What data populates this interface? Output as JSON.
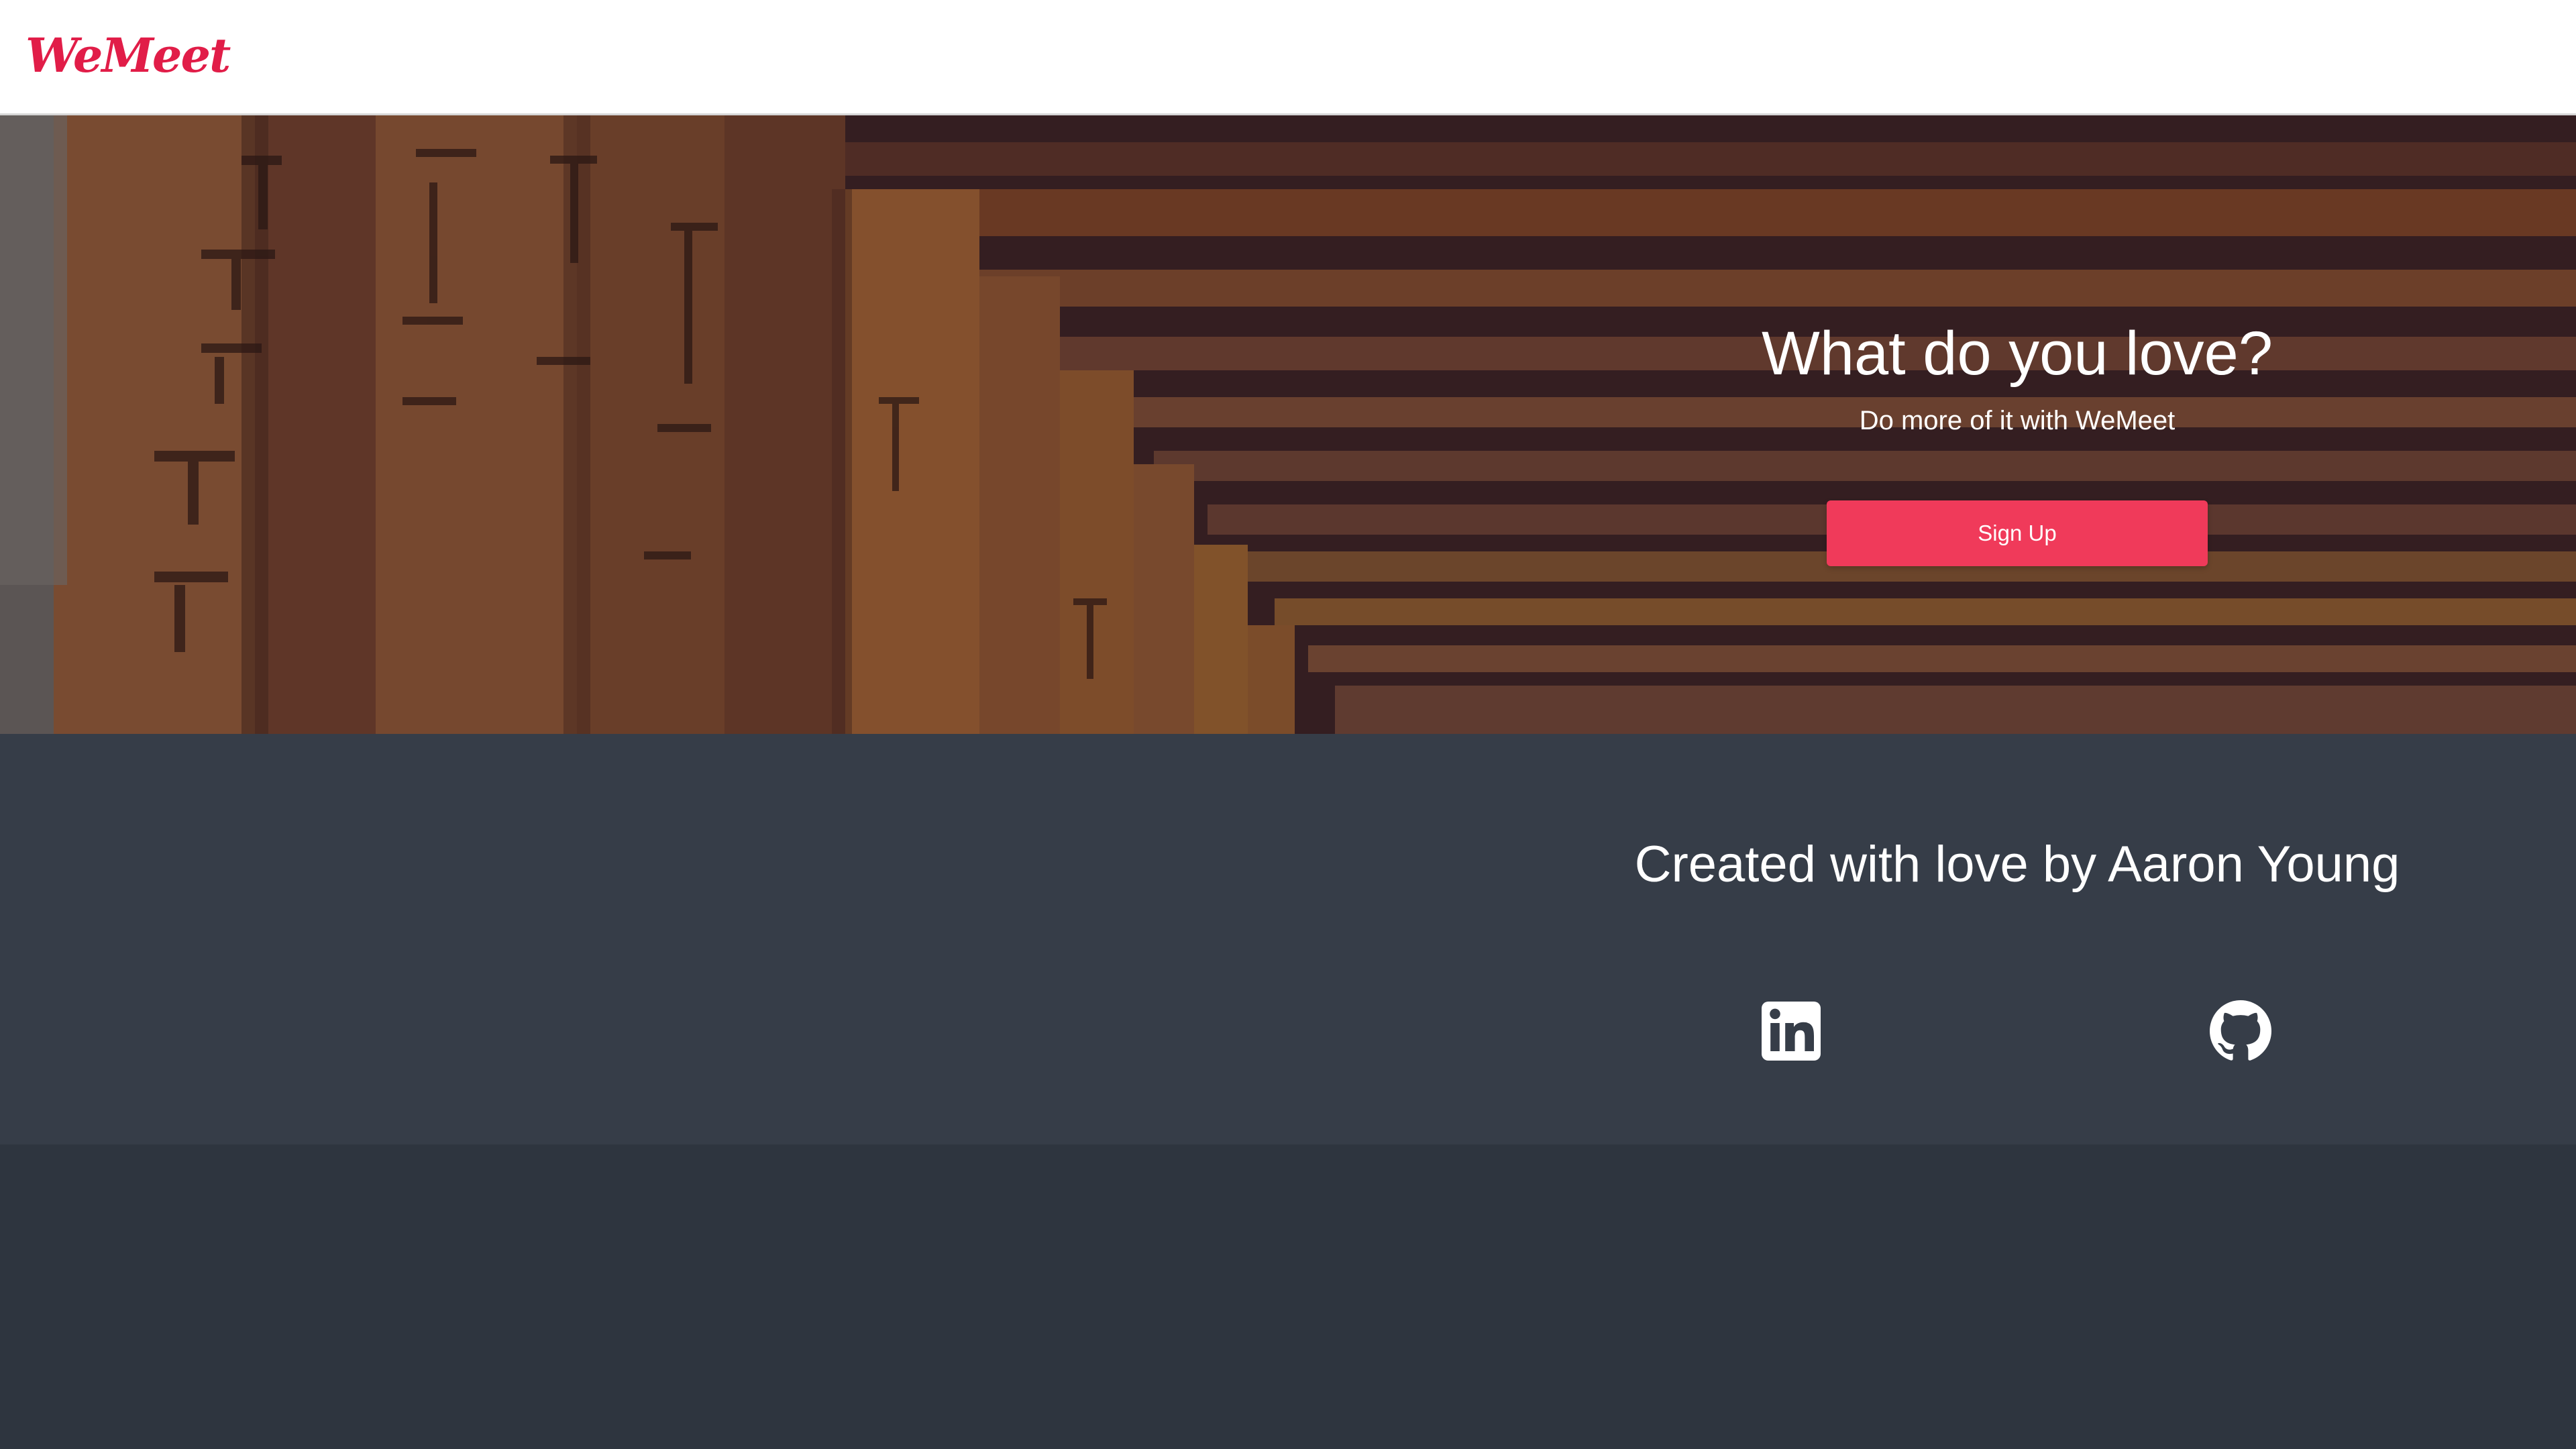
{
  "navbar": {
    "logo_text": "WeMeet"
  },
  "hero": {
    "title": "What do you love?",
    "subtitle": "Do more of it with WeMeet",
    "signup_label": "Sign Up"
  },
  "footer": {
    "title": "Created with love by Aaron Young",
    "social": [
      {
        "icon": "linkedin-icon"
      },
      {
        "icon": "github-icon"
      }
    ]
  },
  "colors": {
    "brand": "#e11d48",
    "button": "#f03a5a",
    "footer_bg": "#363d48",
    "page_bg": "#2e353f"
  }
}
